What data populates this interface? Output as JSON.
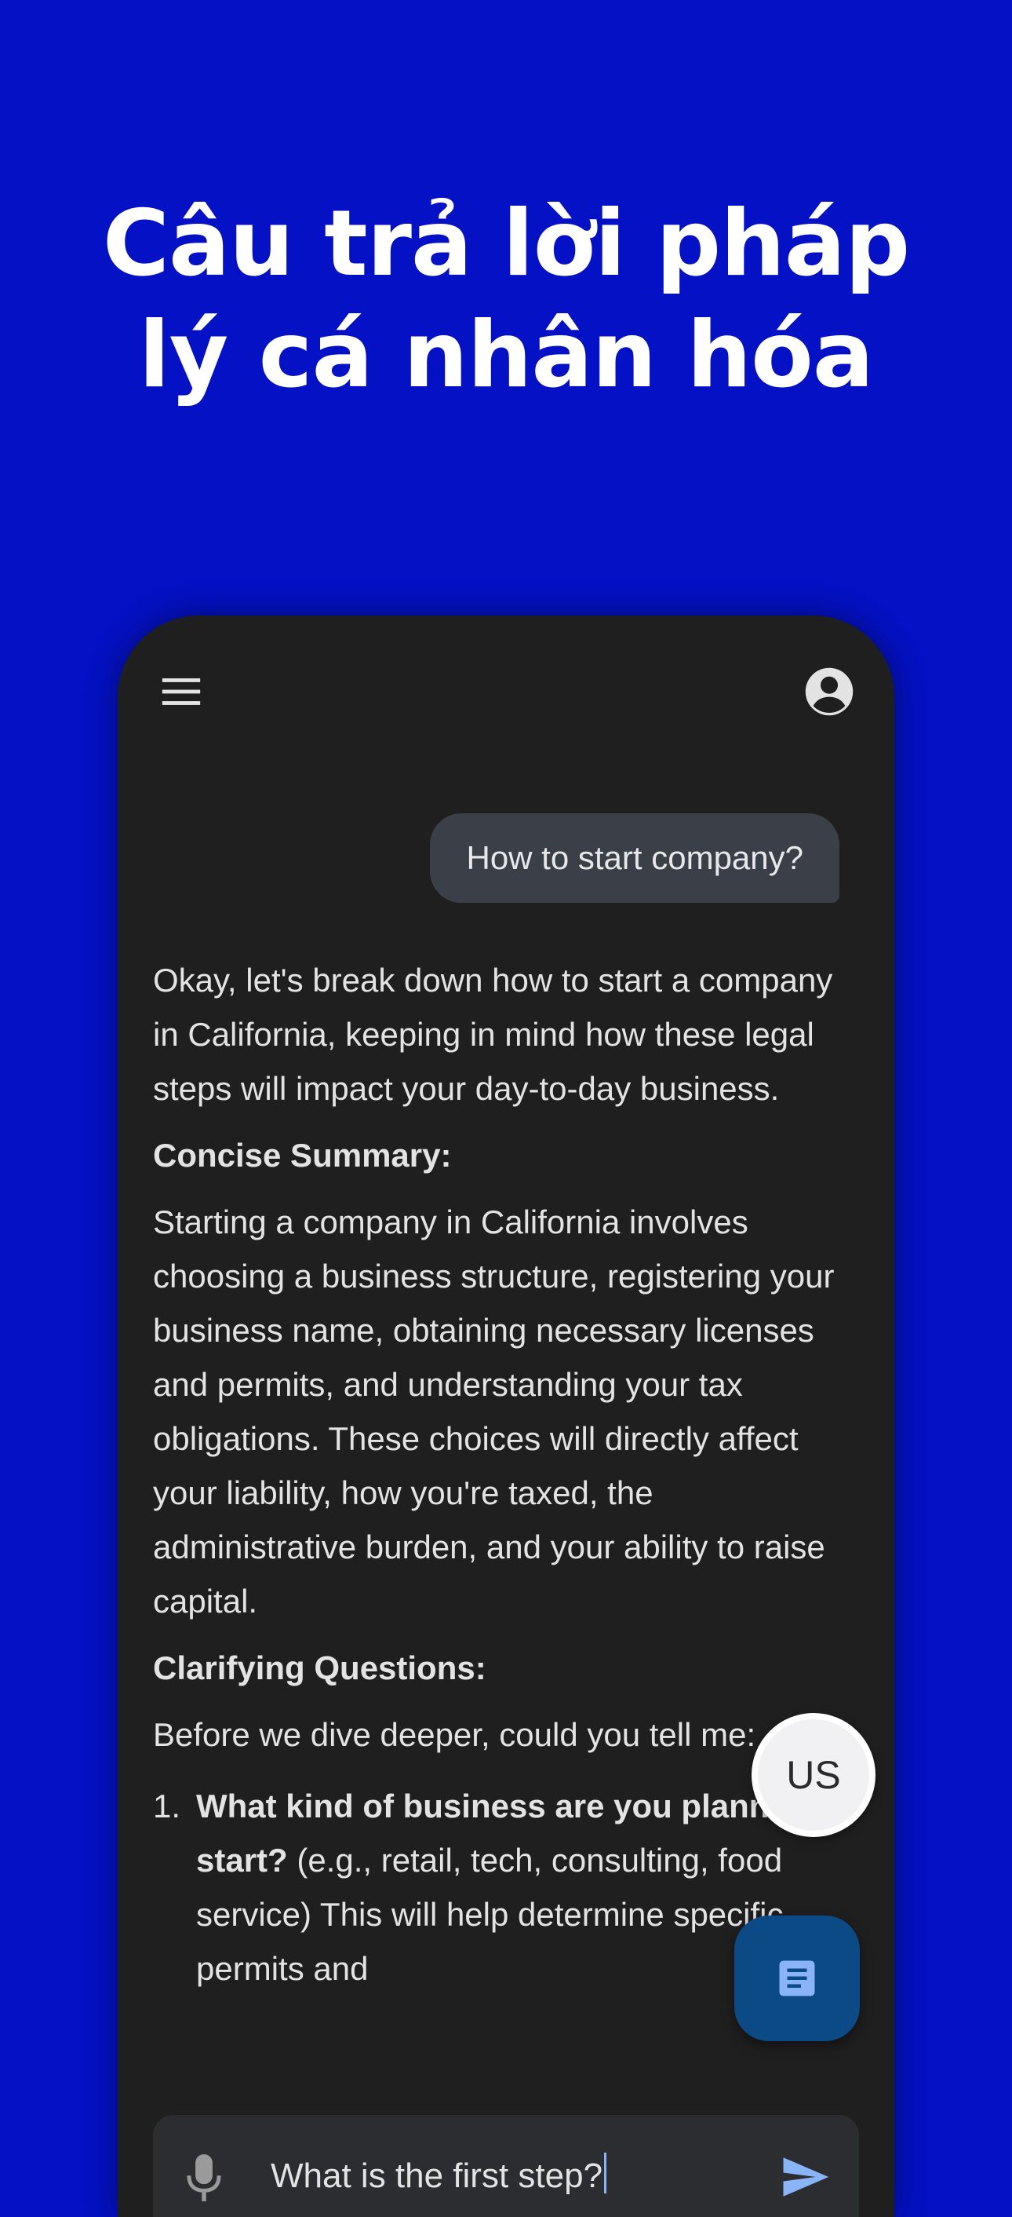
{
  "headline": {
    "line1": "Câu trả lời pháp",
    "line2": "lý cá nhân hóa"
  },
  "colors": {
    "background": "#0411c4",
    "phone_surface": "#1f1f20",
    "user_bubble": "#3b4048",
    "doc_fab": "#0c4a86",
    "accent": "#8ab4f8"
  },
  "app": {
    "icons": {
      "menu": "menu-icon",
      "account": "account-circle-icon",
      "document": "document-icon",
      "mic": "mic-icon",
      "send": "send-icon"
    },
    "user_message": "How to start company?",
    "answer": {
      "intro": "Okay, let's break down how to start a company in California, keeping in mind how these legal steps will impact your day-to-day business.",
      "summary_heading": "Concise Summary:",
      "summary_text": "Starting a company in California involves choosing a business structure, registering your business name, obtaining necessary licenses and permits, and understanding your tax obligations. These choices will directly affect your liability, how you're taxed, the administrative burden, and your ability to raise capital.",
      "questions_heading": "Clarifying Questions:",
      "questions_intro": "Before we dive deeper, could you tell me:",
      "questions": [
        {
          "number": "1.",
          "bold": "What kind of business are you planning to start?",
          "text": " (e.g., retail, tech, consulting, food service) This will help determine specific permits and"
        }
      ]
    },
    "country_button": "US",
    "input": {
      "value": "What is the first step?"
    }
  }
}
